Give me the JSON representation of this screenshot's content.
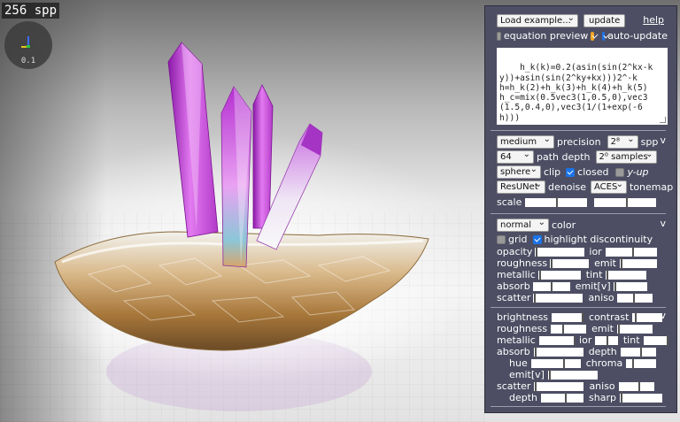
{
  "viewport": {
    "spp_label": "256 spp",
    "gizmo_value": "0.1"
  },
  "panel": {
    "load_example": "Load example...",
    "update": "update",
    "help": "help",
    "equation_preview": "equation preview",
    "auto_update": "auto-update",
    "code": "h_k(k)=0.2(asin(sin(2^kx-k\ny))+asin(sin(2^ky+kx)))2^-k\nh=h_k(2)+h_k(3)+h_k(4)+h_k(5)\nh_c=mix(0.5vec3(1,0.5,0),vec3\n(1.5,0.4,0),vec3(1/(1+exp(-6\nh)))",
    "render": {
      "quality": "medium",
      "precision": "precision",
      "spp_select": "2⁸",
      "spp": "spp",
      "path_depth_select": "64",
      "path_depth": "path depth",
      "samples_select": "2⁰ samples",
      "clip_select": "sphere",
      "clip": "clip",
      "closed": "closed",
      "y_up": "y-up",
      "denoise_select": "ResUNet",
      "denoise": "denoise",
      "tonemap_select": "ACES",
      "tonemap": "tonemap",
      "scale": "scale"
    },
    "material": {
      "color_select": "normal",
      "color": "color",
      "grid": "grid",
      "highlight": "highlight discontinuity",
      "opacity": "opacity",
      "ior": "ior",
      "roughness": "roughness",
      "emit": "emit",
      "metallic": "metallic",
      "tint": "tint",
      "absorb": "absorb",
      "emit_v": "emit[v]",
      "scatter": "scatter",
      "aniso": "aniso"
    },
    "adjust": {
      "brightness": "brightness",
      "contrast": "contrast",
      "roughness": "roughness",
      "emit": "emit",
      "metallic": "metallic",
      "ior": "ior",
      "tint": "tint",
      "absorb": "absorb",
      "depth": "depth",
      "hue": "hue",
      "chroma": "chroma",
      "emit_v": "emit[v]",
      "scatter": "scatter",
      "aniso": "aniso",
      "depth2": "depth",
      "sharp": "sharp"
    },
    "chevron": "v"
  },
  "colors": {
    "panel_bg": "#4d4e63",
    "checkbox_blue": "#1a73e8",
    "checkbox_orange": "#f5a623"
  },
  "state": {
    "equation_preview_checked": true,
    "auto_update_checked": true,
    "closed_checked": true,
    "y_up_checked": false,
    "grid_checked": false,
    "highlight_checked": true
  }
}
